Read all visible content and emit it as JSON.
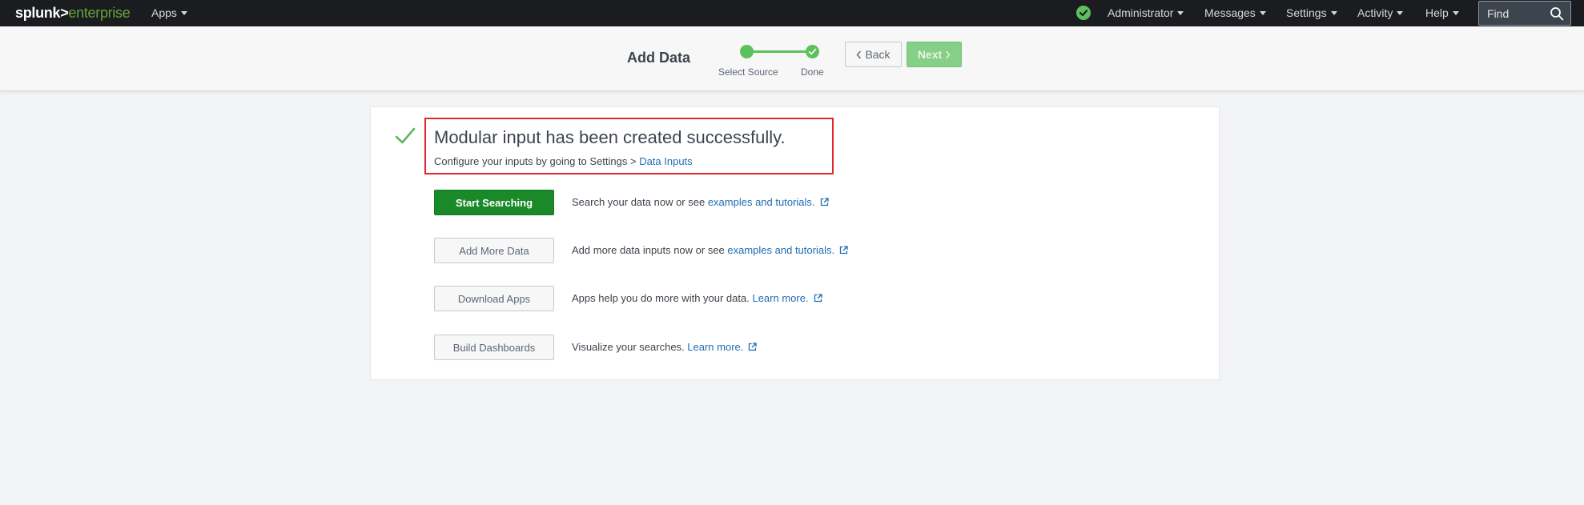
{
  "topbar": {
    "logo_part1": "splunk>",
    "logo_part2": "enterprise",
    "apps_label": "Apps",
    "user_label": "Administrator",
    "messages_label": "Messages",
    "settings_label": "Settings",
    "activity_label": "Activity",
    "help_label": "Help",
    "find_placeholder": "Find",
    "health_color": "#5cc05c"
  },
  "wizard": {
    "title": "Add Data",
    "steps": [
      {
        "label": "Select Source"
      },
      {
        "label": "Done"
      }
    ],
    "back_label": "Back",
    "next_label": "Next",
    "step_color": "#5cc05c"
  },
  "result": {
    "title": "Modular input has been created successfully.",
    "subtitle_prefix": "Configure your inputs by going to Settings > ",
    "subtitle_link": "Data Inputs",
    "check_color": "#5cb85c",
    "highlight_color": "#e0262f"
  },
  "actions": [
    {
      "button": "Start Searching",
      "text": "Search your data now or see ",
      "link": "examples and tutorials."
    },
    {
      "button": "Add More Data",
      "text": "Add more data inputs now or see ",
      "link": "examples and tutorials."
    },
    {
      "button": "Download Apps",
      "text": "Apps help you do more with your data. ",
      "link": "Learn more."
    },
    {
      "button": "Build Dashboards",
      "text": "Visualize your searches. ",
      "link": "Learn more."
    }
  ]
}
